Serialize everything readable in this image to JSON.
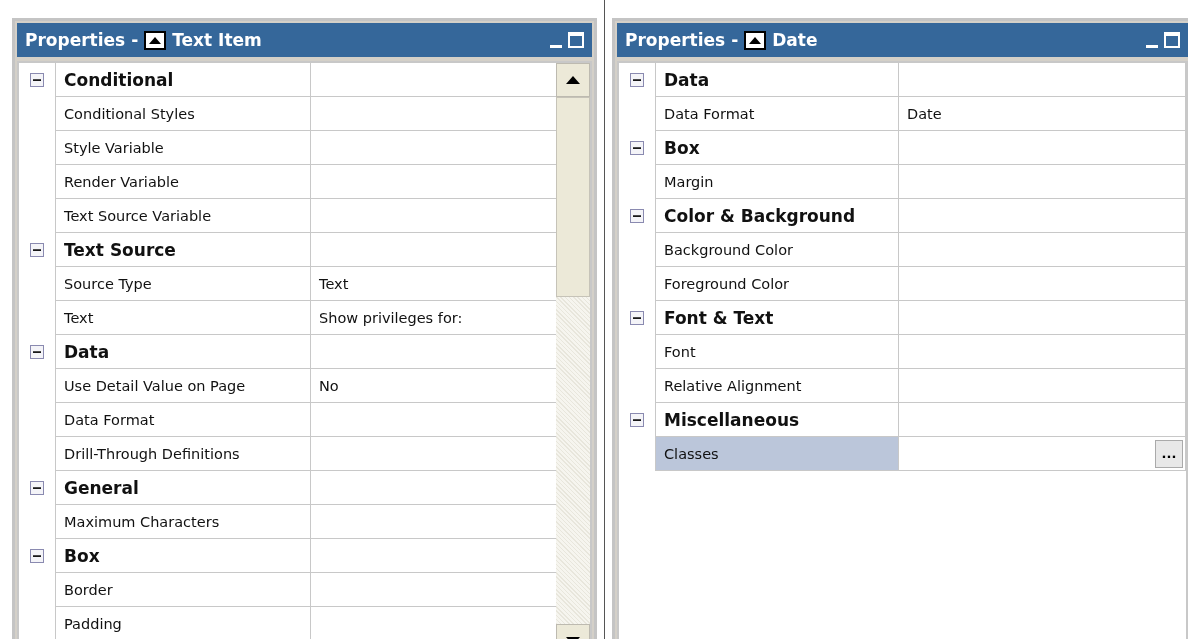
{
  "panels": [
    {
      "title_prefix": "Properties - ",
      "title_name": "Text Item",
      "scrollable": true,
      "sections": [
        {
          "name": "Conditional",
          "expanded": true,
          "properties": [
            {
              "name": "Conditional Styles",
              "selected": false
            },
            {
              "name": "Style Variable",
              "selected": false
            },
            {
              "name": "Render Variable",
              "selected": false
            },
            {
              "name": "Text Source Variable",
              "selected": false
            }
          ]
        },
        {
          "name": "Text Source",
          "expanded": true,
          "properties": [
            {
              "name": "Source Type",
              "value": "Text",
              "selected": false
            },
            {
              "name": "Text",
              "value": "Show privileges for:",
              "selected": false
            }
          ]
        },
        {
          "name": "Data",
          "expanded": true,
          "properties": [
            {
              "name": "Use Detail Value on Page",
              "value": "No",
              "selected": false
            },
            {
              "name": "Data Format",
              "selected": false
            },
            {
              "name": "Drill-Through Definitions",
              "selected": false
            }
          ]
        },
        {
          "name": "General",
          "expanded": true,
          "properties": [
            {
              "name": "Maximum Characters",
              "selected": false
            }
          ]
        },
        {
          "name": "Box",
          "expanded": true,
          "properties": [
            {
              "name": "Border",
              "selected": false
            },
            {
              "name": "Padding",
              "selected": false
            }
          ]
        }
      ]
    },
    {
      "title_prefix": "Properties - ",
      "title_name": "Date",
      "scrollable": false,
      "sections": [
        {
          "name": "Data",
          "expanded": true,
          "properties": [
            {
              "name": "Data Format",
              "value": "Date",
              "selected": false
            }
          ]
        },
        {
          "name": "Box",
          "expanded": true,
          "properties": [
            {
              "name": "Margin",
              "selected": false
            }
          ]
        },
        {
          "name": "Color & Background",
          "expanded": true,
          "properties": [
            {
              "name": "Background Color",
              "selected": false
            },
            {
              "name": "Foreground Color",
              "selected": false
            }
          ]
        },
        {
          "name": "Font & Text",
          "expanded": true,
          "properties": [
            {
              "name": "Font",
              "selected": false
            },
            {
              "name": "Relative Alignment",
              "selected": false
            }
          ]
        },
        {
          "name": "Miscellaneous",
          "expanded": true,
          "properties": [
            {
              "name": "Classes",
              "selected": true,
              "button": "..."
            }
          ]
        }
      ]
    }
  ]
}
